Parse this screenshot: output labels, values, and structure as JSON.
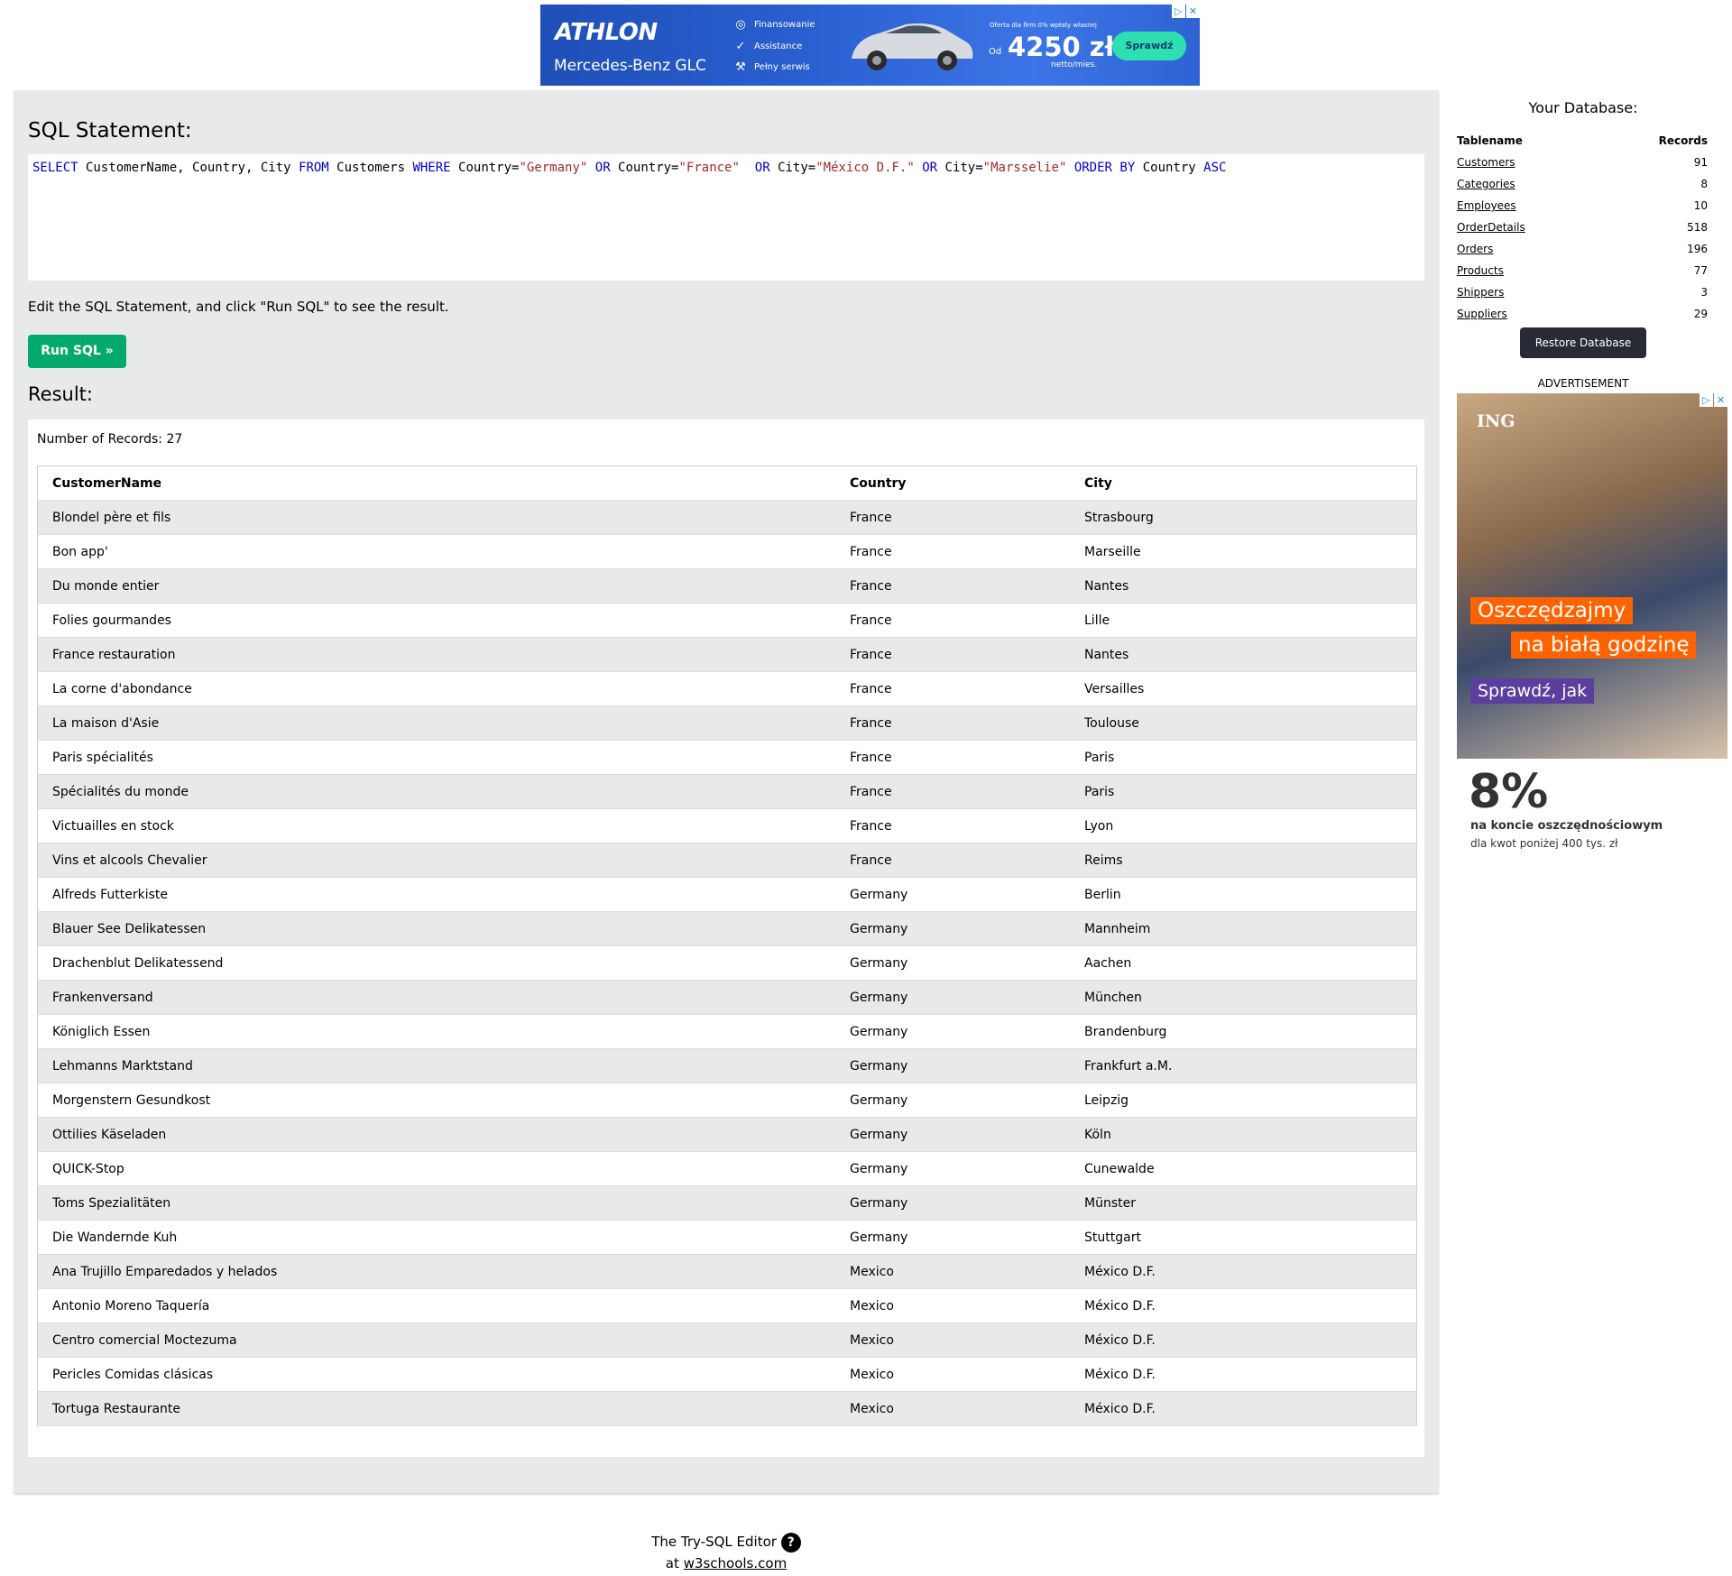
{
  "top_ad": {
    "brand": "ATHLON",
    "model": "Mercedes-Benz GLC",
    "features": [
      "Finansowanie",
      "Assistance",
      "Pełny serwis"
    ],
    "offer_small": "Oferta dla firm     0% wpłaty własnej",
    "od": "Od",
    "price": "4250 zł",
    "netto": "netto/mies.",
    "cta": "Sprawdź"
  },
  "editor": {
    "sql_heading": "SQL Statement:",
    "sql_statement": "SELECT CustomerName, Country, City FROM Customers WHERE Country=\"Germany\" OR Country=\"France\"  OR City=\"México D.F.\" OR City=\"Marsselie\" ORDER BY Country ASC",
    "instructions": "Edit the SQL Statement, and click \"Run SQL\" to see the result.",
    "run_button": "Run SQL »",
    "result_heading": "Result:",
    "record_count": "Number of Records: 27"
  },
  "results": {
    "columns": [
      "CustomerName",
      "Country",
      "City"
    ],
    "rows": [
      [
        "Blondel père et fils",
        "France",
        "Strasbourg"
      ],
      [
        "Bon app'",
        "France",
        "Marseille"
      ],
      [
        "Du monde entier",
        "France",
        "Nantes"
      ],
      [
        "Folies gourmandes",
        "France",
        "Lille"
      ],
      [
        "France restauration",
        "France",
        "Nantes"
      ],
      [
        "La corne d'abondance",
        "France",
        "Versailles"
      ],
      [
        "La maison d'Asie",
        "France",
        "Toulouse"
      ],
      [
        "Paris spécialités",
        "France",
        "Paris"
      ],
      [
        "Spécialités du monde",
        "France",
        "Paris"
      ],
      [
        "Victuailles en stock",
        "France",
        "Lyon"
      ],
      [
        "Vins et alcools Chevalier",
        "France",
        "Reims"
      ],
      [
        "Alfreds Futterkiste",
        "Germany",
        "Berlin"
      ],
      [
        "Blauer See Delikatessen",
        "Germany",
        "Mannheim"
      ],
      [
        "Drachenblut Delikatessend",
        "Germany",
        "Aachen"
      ],
      [
        "Frankenversand",
        "Germany",
        "München"
      ],
      [
        "Königlich Essen",
        "Germany",
        "Brandenburg"
      ],
      [
        "Lehmanns Marktstand",
        "Germany",
        "Frankfurt a.M."
      ],
      [
        "Morgenstern Gesundkost",
        "Germany",
        "Leipzig"
      ],
      [
        "Ottilies Käseladen",
        "Germany",
        "Köln"
      ],
      [
        "QUICK-Stop",
        "Germany",
        "Cunewalde"
      ],
      [
        "Toms Spezialitäten",
        "Germany",
        "Münster"
      ],
      [
        "Die Wandernde Kuh",
        "Germany",
        "Stuttgart"
      ],
      [
        "Ana Trujillo Emparedados y helados",
        "Mexico",
        "México D.F."
      ],
      [
        "Antonio Moreno Taquería",
        "Mexico",
        "México D.F."
      ],
      [
        "Centro comercial Moctezuma",
        "Mexico",
        "México D.F."
      ],
      [
        "Pericles Comidas clásicas",
        "Mexico",
        "México D.F."
      ],
      [
        "Tortuga Restaurante",
        "Mexico",
        "México D.F."
      ]
    ]
  },
  "database": {
    "heading": "Your Database:",
    "col_tablename": "Tablename",
    "col_records": "Records",
    "tables": [
      {
        "name": "Customers",
        "records": "91"
      },
      {
        "name": "Categories",
        "records": "8"
      },
      {
        "name": "Employees",
        "records": "10"
      },
      {
        "name": "OrderDetails",
        "records": "518"
      },
      {
        "name": "Orders",
        "records": "196"
      },
      {
        "name": "Products",
        "records": "77"
      },
      {
        "name": "Shippers",
        "records": "3"
      },
      {
        "name": "Suppliers",
        "records": "29"
      }
    ],
    "restore_button": "Restore Database"
  },
  "side_ad": {
    "label": "ADVERTISEMENT",
    "brand": "ING",
    "line1": "Oszczędzajmy",
    "line2": "na białą godzinę",
    "cta": "Sprawdź, jak",
    "rate": "8%",
    "rate_desc": "na koncie oszczędnościowym",
    "rate_note": "dla kwot poniżej 400 tys. zł"
  },
  "footer": {
    "editor_name": "The Try-SQL Editor",
    "help": "?",
    "at": "at",
    "site": "w3schools.com"
  }
}
